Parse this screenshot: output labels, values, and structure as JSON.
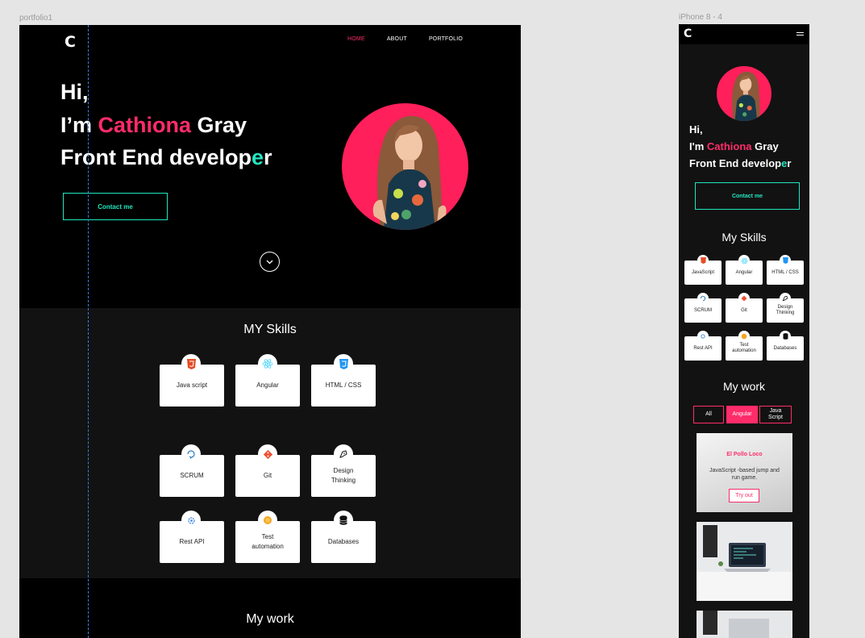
{
  "canvas": {
    "desktop_frame_label": "portfolio1",
    "mobile_frame_label": "iPhone 8 - 4"
  },
  "desktop": {
    "logo": "C",
    "nav": [
      "HOME",
      "ABOUT",
      "PORTFOLIO"
    ],
    "nav_active_index": 0,
    "hero": {
      "line1": "Hi,",
      "line2_prefix": "I’m ",
      "name_first": "Cathiona",
      "name_last": " Gray",
      "line3_prefix": "Front End develop",
      "line3_highlight": "e",
      "line3_suffix": "r"
    },
    "contact_label": "Contact me",
    "skills_title": "MY Skills",
    "skills": [
      {
        "label": "Java script",
        "icon": "html5-icon"
      },
      {
        "label": "Angular",
        "icon": "react-icon"
      },
      {
        "label": "HTML / CSS",
        "icon": "css3-icon"
      },
      {
        "label": "SCRUM",
        "icon": "scrum-cycle-icon"
      },
      {
        "label": "Git",
        "icon": "git-icon"
      },
      {
        "label": "Design Thinking",
        "icon": "pen-nib-icon"
      },
      {
        "label": "Rest API",
        "icon": "api-gear-icon"
      },
      {
        "label": "Test automation",
        "icon": "coin-icon"
      },
      {
        "label": "Databases",
        "icon": "database-icon"
      }
    ],
    "work_title": "My work"
  },
  "mobile": {
    "logo": "C",
    "hero": {
      "line1": "Hi,",
      "line2_prefix": "I'm ",
      "name_first": "Cathiona",
      "name_last": " Gray",
      "line3_prefix": "Front End develop",
      "line3_highlight": "e",
      "line3_suffix": "r"
    },
    "contact_label": "Contact me",
    "skills_title": "My Skills",
    "skills": [
      {
        "label": "JavaScript",
        "icon": "html5-icon"
      },
      {
        "label": "Angular",
        "icon": "react-icon"
      },
      {
        "label": "HTML / CSS",
        "icon": "css3-icon"
      },
      {
        "label": "SCRUM",
        "icon": "scrum-cycle-icon"
      },
      {
        "label": "Git",
        "icon": "git-icon"
      },
      {
        "label": "Design Thinking",
        "icon": "pen-nib-icon"
      },
      {
        "label": "Rest API",
        "icon": "api-gear-icon"
      },
      {
        "label": "Test automation",
        "icon": "coin-icon"
      },
      {
        "label": "Databases",
        "icon": "database-icon"
      }
    ],
    "work_title": "My work",
    "filters": [
      "All",
      "Angular",
      "Java Script"
    ],
    "filter_active_index": 1,
    "project": {
      "title": "El Pollo Loco",
      "description": "JavaScript -based jump and run game.",
      "button": "Try out"
    }
  },
  "colors": {
    "accent_pink": "#ff2c6a",
    "accent_teal": "#21e6c1",
    "avatar_bg": "#ff1f5a",
    "desktop_bg": "#000000",
    "section_bg": "#121212"
  }
}
